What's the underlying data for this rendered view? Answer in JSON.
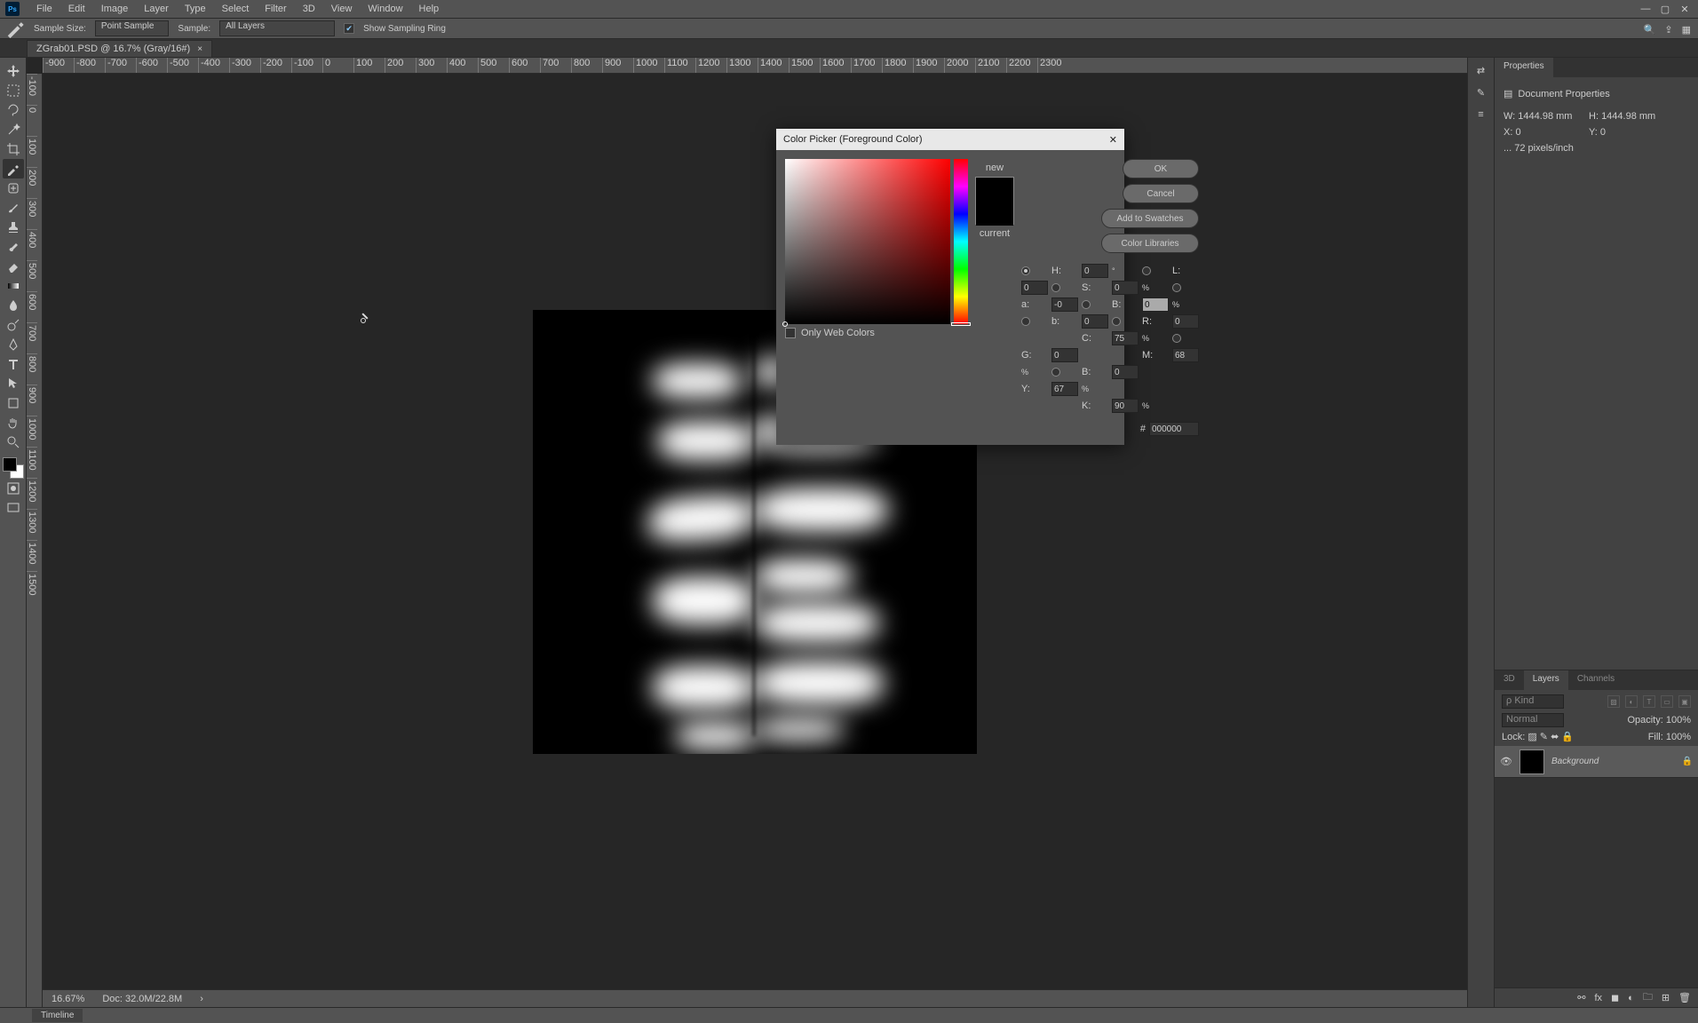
{
  "menu": [
    "File",
    "Edit",
    "Image",
    "Layer",
    "Type",
    "Select",
    "Filter",
    "3D",
    "View",
    "Window",
    "Help"
  ],
  "optionsBar": {
    "sampleSizeLabel": "Sample Size:",
    "sampleSizeValue": "Point Sample",
    "sampleLabel": "Sample:",
    "sampleValue": "All Layers",
    "showSamplingLabel": "Show Sampling Ring"
  },
  "document": {
    "tabTitle": "ZGrab01.PSD @ 16.7% (Gray/16#)"
  },
  "hruler": [
    "-900",
    "-800",
    "-700",
    "-600",
    "-500",
    "-400",
    "-300",
    "-200",
    "-100",
    "0",
    "100",
    "200",
    "300",
    "400",
    "500",
    "600",
    "700",
    "800",
    "900",
    "1000",
    "1100",
    "1200",
    "1300",
    "1400",
    "1500",
    "1600",
    "1700",
    "1800",
    "1900",
    "2000",
    "2100",
    "2200",
    "2300"
  ],
  "vruler": [
    "-100",
    "0",
    "100",
    "200",
    "300",
    "400",
    "500",
    "600",
    "700",
    "800",
    "900",
    "1000",
    "1100",
    "1200",
    "1300",
    "1400",
    "1500"
  ],
  "status": {
    "zoom": "16.67%",
    "docInfo": "Doc: 32.0M/22.8M"
  },
  "properties": {
    "tab": "Properties",
    "section": "Document Properties",
    "w": "1444.98 mm",
    "h": "1444.98 mm",
    "x": "0",
    "y": "0",
    "res": "... 72 pixels/inch"
  },
  "layersPanel": {
    "tabs": [
      "3D",
      "Layers",
      "Channels"
    ],
    "kind": "ρ Kind",
    "blend": "Normal",
    "opacityLabel": "Opacity:",
    "opacityVal": "100%",
    "lockLabel": "Lock:",
    "fillLabel": "Fill:",
    "fillVal": "100%",
    "layer": {
      "name": "Background"
    }
  },
  "timeline": {
    "tab": "Timeline"
  },
  "colorPicker": {
    "title": "Color Picker (Foreground Color)",
    "ok": "OK",
    "cancel": "Cancel",
    "swatches": "Add to Swatches",
    "libs": "Color Libraries",
    "new": "new",
    "current": "current",
    "webOnly": "Only Web Colors",
    "H": "0",
    "S": "0",
    "B": "0",
    "R": "0",
    "G": "0",
    "Bb": "0",
    "L": "0",
    "a": "-0",
    "b": "0",
    "C": "75",
    "M": "68",
    "Y": "67",
    "K": "90",
    "hex": "000000"
  }
}
